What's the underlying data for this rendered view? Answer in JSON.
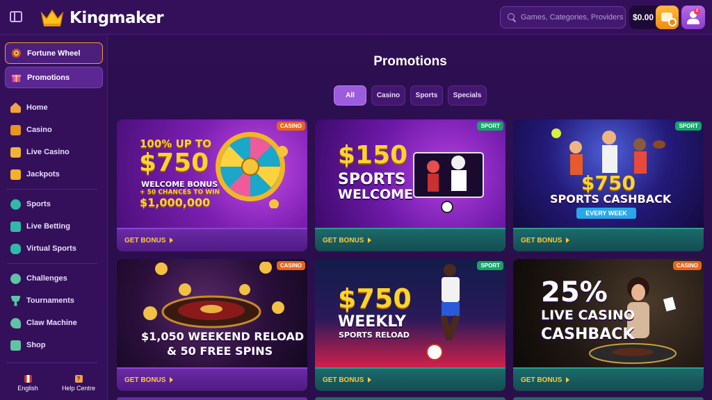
{
  "header": {
    "logo_text": "Kingmaker",
    "search_placeholder": "Games, Categories, Providers",
    "balance": "$0.00",
    "notification_count": "2"
  },
  "sidebar": {
    "featured": [
      {
        "label": "Fortune Wheel",
        "icon": "fortune-wheel-icon"
      },
      {
        "label": "Promotions",
        "icon": "gift-icon"
      }
    ],
    "groups": [
      [
        {
          "label": "Home",
          "icon": "home-icon"
        },
        {
          "label": "Casino",
          "icon": "casino-icon"
        },
        {
          "label": "Live Casino",
          "icon": "live-casino-icon"
        },
        {
          "label": "Jackpots",
          "icon": "jackpot-icon"
        }
      ],
      [
        {
          "label": "Sports",
          "icon": "soccer-ball-icon"
        },
        {
          "label": "Live Betting",
          "icon": "live-betting-icon"
        },
        {
          "label": "Virtual Sports",
          "icon": "gamepad-icon"
        }
      ],
      [
        {
          "label": "Challenges",
          "icon": "challenge-icon"
        },
        {
          "label": "Tournaments",
          "icon": "trophy-icon"
        },
        {
          "label": "Claw Machine",
          "icon": "claw-icon"
        },
        {
          "label": "Shop",
          "icon": "shop-bag-icon"
        }
      ]
    ],
    "footer": {
      "language": "English",
      "help": "Help Centre"
    }
  },
  "main": {
    "title": "Promotions",
    "filters": [
      "All",
      "Casino",
      "Sports",
      "Specials"
    ],
    "active_filter": "All",
    "cards": [
      {
        "tag": "CASINO",
        "cta": "GET BONUS",
        "lines": [
          "100% UP TO",
          "$750",
          "WELCOME BONUS",
          "+ 50 CHANCES TO WIN",
          "$1,000,000"
        ]
      },
      {
        "tag": "SPORT",
        "cta": "GET BONUS",
        "lines": [
          "$150",
          "SPORTS",
          "WELCOME"
        ]
      },
      {
        "tag": "SPORT",
        "cta": "GET BONUS",
        "lines": [
          "$750",
          "SPORTS CASHBACK",
          "EVERY WEEK"
        ]
      },
      {
        "tag": "CASINO",
        "cta": "GET BONUS",
        "lines": [
          "$1,050 WEEKEND RELOAD",
          "& 50 FREE SPINS"
        ]
      },
      {
        "tag": "SPORT",
        "cta": "GET BONUS",
        "lines": [
          "$750",
          "WEEKLY",
          "SPORTS RELOAD"
        ]
      },
      {
        "tag": "CASINO",
        "cta": "GET BONUS",
        "lines": [
          "25%",
          "LIVE CASINO",
          "CASHBACK"
        ]
      }
    ]
  },
  "colors": {
    "accent_orange": "#f08c13",
    "accent_purple": "#9b5cde",
    "cta_yellow": "#ffc93a",
    "casino_tag": "#e8641b",
    "sport_tag": "#19a36a"
  }
}
